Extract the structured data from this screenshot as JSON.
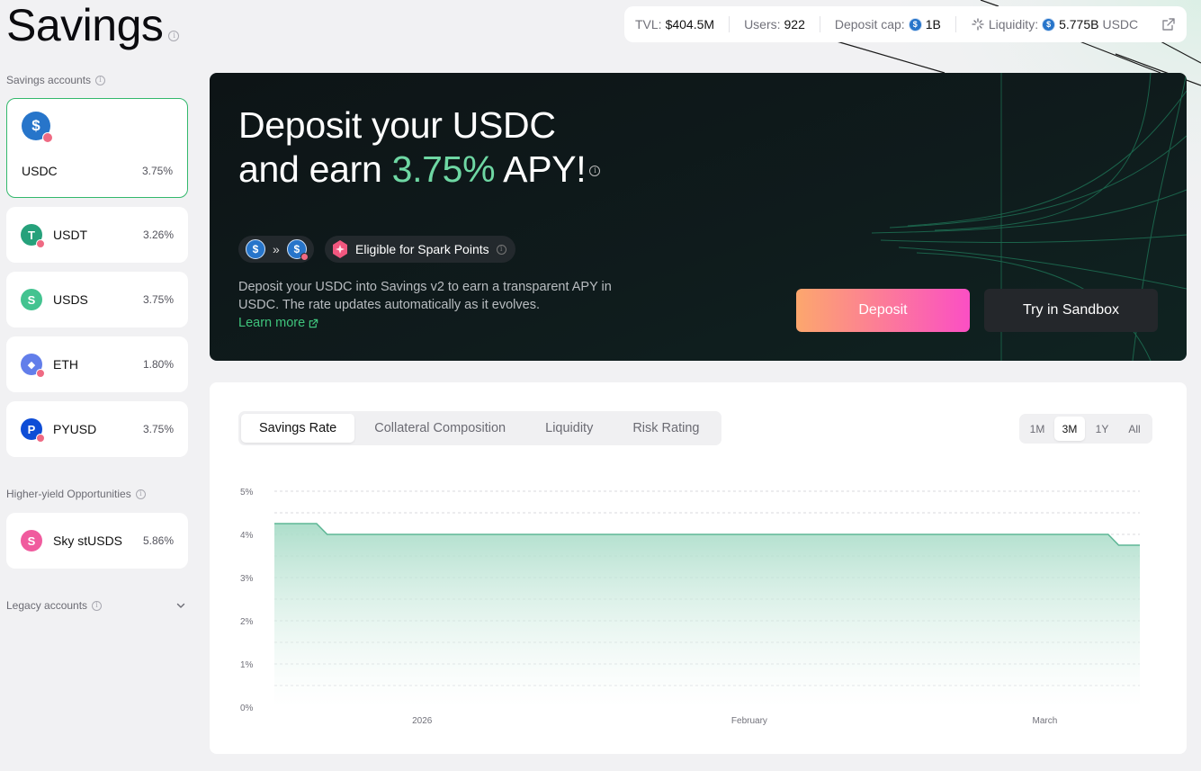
{
  "page": {
    "title": "Savings"
  },
  "stats": {
    "tvl_label": "TVL:",
    "tvl_value": "$404.5M",
    "users_label": "Users:",
    "users_value": "922",
    "cap_label": "Deposit cap:",
    "cap_value": "1B",
    "liq_label": "Liquidity:",
    "liq_value": "5.775B",
    "liq_unit": "USDC"
  },
  "sidebar": {
    "savings_label": "Savings accounts",
    "accounts": [
      {
        "name": "USDC",
        "rate": "3.75%",
        "color": "#2775ca",
        "glyph": "$"
      },
      {
        "name": "USDT",
        "rate": "3.26%",
        "color": "#26a17b",
        "glyph": "T"
      },
      {
        "name": "USDS",
        "rate": "3.75%",
        "color": "#43c390",
        "glyph": "S"
      },
      {
        "name": "ETH",
        "rate": "1.80%",
        "color": "#627eea",
        "glyph": "◆"
      },
      {
        "name": "PYUSD",
        "rate": "3.75%",
        "color": "#0e4dd6",
        "glyph": "P"
      }
    ],
    "higher_label": "Higher-yield Opportunities",
    "higher": [
      {
        "name": "Sky stUSDS",
        "rate": "5.86%",
        "color": "#f05b9e",
        "glyph": "S"
      }
    ],
    "legacy_label": "Legacy accounts"
  },
  "hero": {
    "title_line1": "Deposit your USDC",
    "title_line2_prefix": "and earn ",
    "title_apy": "3.75%",
    "title_line2_suffix": " APY!",
    "points_label": "Eligible for Spark Points",
    "description": "Deposit your USDC into Savings v2 to earn a transparent APY in USDC. The rate updates automatically as it evolves.",
    "learn_more": "Learn more",
    "deposit_button": "Deposit",
    "sandbox_button": "Try in Sandbox"
  },
  "panel": {
    "tabs": [
      "Savings Rate",
      "Collateral Composition",
      "Liquidity",
      "Risk Rating"
    ],
    "active_tab": 0,
    "ranges": [
      "1M",
      "3M",
      "1Y",
      "All"
    ],
    "active_range": 1
  },
  "colors": {
    "accent_green": "#6ed7a3",
    "selected_border": "#33b86c",
    "chart_line": "#5fb796",
    "chart_fill": "#bfe5d8"
  },
  "chart_data": {
    "type": "area",
    "x": [
      "2025-12-18",
      "2025-12-22",
      "2025-12-23",
      "2026-03-07",
      "2026-03-08",
      "2026-03-10"
    ],
    "values": [
      4.25,
      4.25,
      4.0,
      4.0,
      3.75,
      3.75
    ],
    "interpolation": "step",
    "x_range": [
      "2025-12-18",
      "2026-03-10"
    ],
    "x_tick_labels": [
      {
        "label": "2026",
        "date": "2026-01-01"
      },
      {
        "label": "February",
        "date": "2026-02-01"
      },
      {
        "label": "March",
        "date": "2026-03-01"
      }
    ],
    "y_ticks": [
      "0%",
      "1%",
      "2%",
      "3%",
      "4%",
      "5%"
    ],
    "ylim": [
      0,
      5
    ],
    "grid": true
  }
}
